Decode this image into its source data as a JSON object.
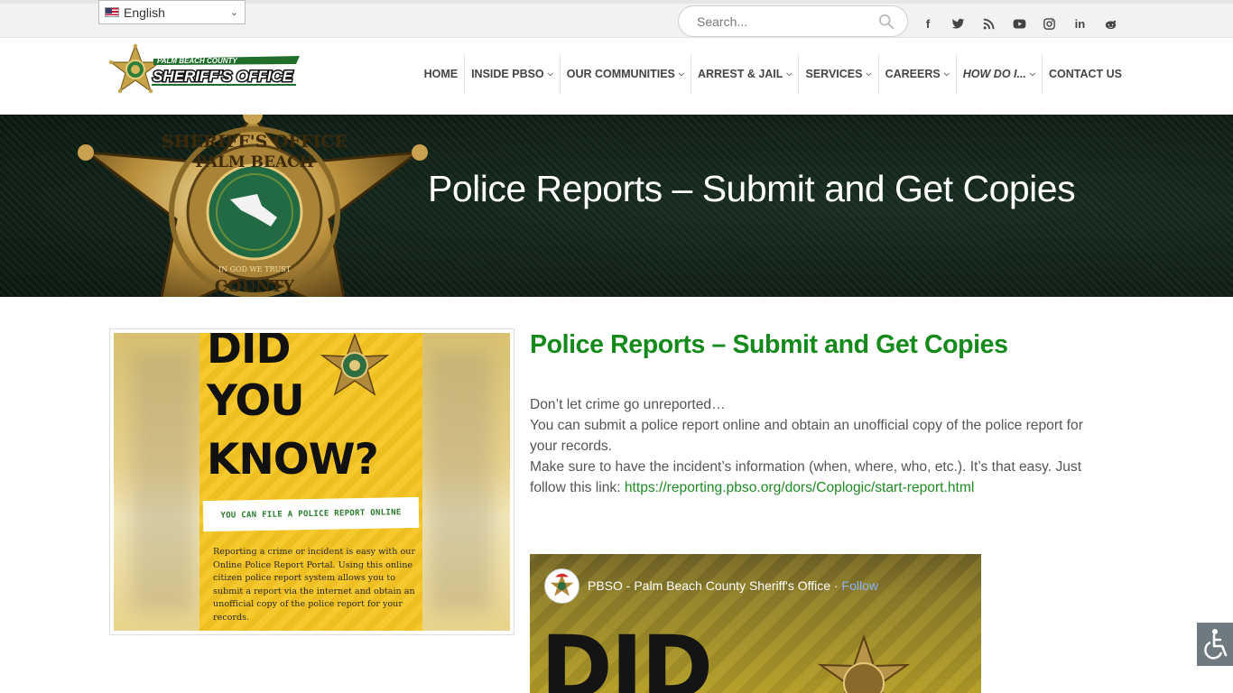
{
  "language_selector": {
    "label": "English",
    "flag_icon": "us-flag-icon"
  },
  "search": {
    "placeholder": "Search..."
  },
  "socials": [
    {
      "name": "facebook-icon",
      "glyph": "f"
    },
    {
      "name": "twitter-icon",
      "glyph": ""
    },
    {
      "name": "rss-icon",
      "glyph": ""
    },
    {
      "name": "youtube-icon",
      "glyph": ""
    },
    {
      "name": "instagram-icon",
      "glyph": ""
    },
    {
      "name": "linkedin-icon",
      "glyph": "in"
    },
    {
      "name": "reddit-icon",
      "glyph": ""
    }
  ],
  "logo": {
    "top_text": "PALM BEACH COUNTY",
    "main_text": "SHERIFF'S OFFICE"
  },
  "nav": [
    {
      "label": "HOME",
      "dropdown": false
    },
    {
      "label": "INSIDE PBSO",
      "dropdown": true
    },
    {
      "label": "OUR COMMUNITIES",
      "dropdown": true
    },
    {
      "label": "ARREST & JAIL",
      "dropdown": true
    },
    {
      "label": "SERVICES",
      "dropdown": true
    },
    {
      "label": "CAREERS",
      "dropdown": true
    },
    {
      "label": "HOW DO I...",
      "dropdown": true
    },
    {
      "label": "CONTACT US",
      "dropdown": false
    }
  ],
  "banner": {
    "title": "Police Reports – Submit and Get Copies",
    "badge_text": {
      "top": "SHERIFF'S OFFICE",
      "middle": "PALM BEACH",
      "bottom": "COUNTY",
      "seal": "IN GOD WE TRUST"
    }
  },
  "poster": {
    "line1": "DID",
    "line2": "YOU",
    "line3": "KNOW?",
    "strip": "YOU CAN FILE A POLICE REPORT ONLINE",
    "body": "Reporting a crime or incident is easy with our Online Police Report Portal. Using this online citizen police report system allows you to submit a report via the internet and obtain an unofficial copy of the police report for your records."
  },
  "article": {
    "title": "Police Reports – Submit and Get Copies",
    "p1": "Don’t let crime go unreported…",
    "p2": "You can submit a police report online and obtain an unofficial copy of the police report for your records.",
    "p3": "Make sure to have the incident’s information (when, where, who, etc.). It’s that easy. Just follow this link: ",
    "link": "https://reporting.pbso.org/dors/Coplogic/start-report.html"
  },
  "facebook_embed": {
    "page_name": "PBSO - Palm Beach County Sheriff's Office",
    "separator": " · ",
    "follow_label": "Follow",
    "preview_text": "DID"
  },
  "accessibility": {
    "icon": "wheelchair-icon"
  },
  "colors": {
    "brand_green": "#138a1a",
    "link_green": "#1e8a22",
    "banner_bg": "#12231a"
  }
}
